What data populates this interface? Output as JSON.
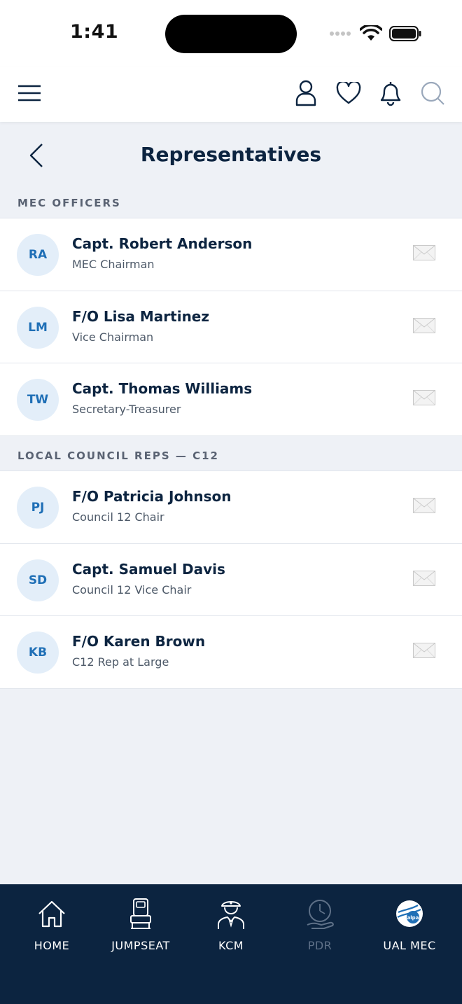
{
  "status_bar": {
    "time": "1:41"
  },
  "page": {
    "title": "Representatives"
  },
  "sections": [
    {
      "label": "MEC OFFICERS",
      "reps": [
        {
          "initials": "RA",
          "name": "Capt. Robert Anderson",
          "role": "MEC Chairman"
        },
        {
          "initials": "LM",
          "name": "F/O Lisa Martinez",
          "role": "Vice Chairman"
        },
        {
          "initials": "TW",
          "name": "Capt. Thomas Williams",
          "role": "Secretary-Treasurer"
        }
      ]
    },
    {
      "label": "LOCAL COUNCIL REPS — C12",
      "reps": [
        {
          "initials": "PJ",
          "name": "F/O Patricia Johnson",
          "role": "Council 12 Chair"
        },
        {
          "initials": "SD",
          "name": "Capt. Samuel Davis",
          "role": "Council 12 Vice Chair"
        },
        {
          "initials": "KB",
          "name": "F/O Karen Brown",
          "role": "C12 Rep at Large"
        }
      ]
    }
  ],
  "tab_bar": {
    "tabs": [
      {
        "label": "HOME",
        "icon": "home-icon"
      },
      {
        "label": "JUMPSEAT",
        "icon": "jumpseat-icon"
      },
      {
        "label": "KCM",
        "icon": "pilot-icon"
      },
      {
        "label": "PDR",
        "icon": "clock-hand-icon",
        "disabled": true
      },
      {
        "label": "UAL MEC",
        "icon": "alpa-logo-icon"
      }
    ]
  },
  "colors": {
    "navy": "#0c2440",
    "accent": "#1f6fb6",
    "avatar_bg": "#e3eef9",
    "page_bg": "#eef1f6"
  }
}
